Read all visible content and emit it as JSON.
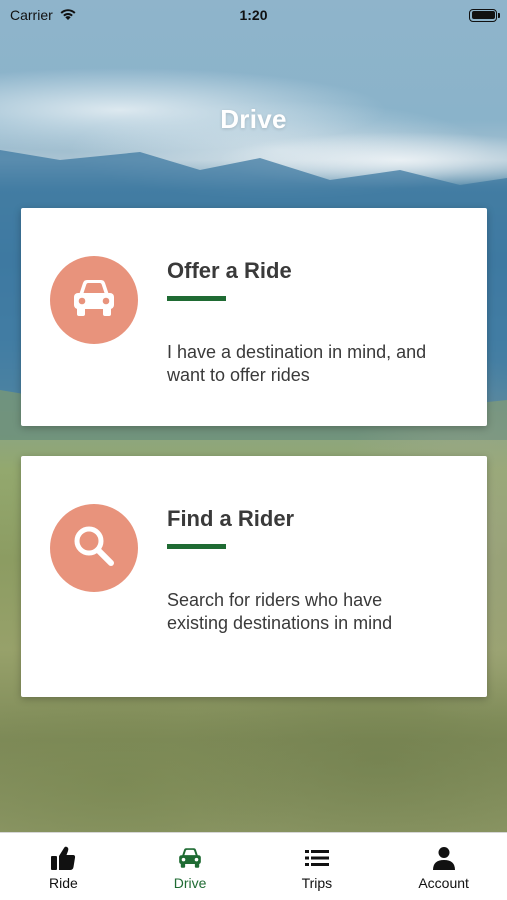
{
  "status_bar": {
    "carrier": "Carrier",
    "time": "1:20"
  },
  "page": {
    "title": "Drive"
  },
  "cards": [
    {
      "title": "Offer a Ride",
      "description": "I have a destination in mind, and want to offer rides",
      "icon": "car-icon"
    },
    {
      "title": "Find a Rider",
      "description": "Search for riders who have existing destinations in mind",
      "icon": "search-icon"
    }
  ],
  "tab_bar": {
    "active": "Drive",
    "tabs": [
      {
        "label": "Ride",
        "icon": "thumbs-up-icon"
      },
      {
        "label": "Drive",
        "icon": "car-icon"
      },
      {
        "label": "Trips",
        "icon": "list-icon"
      },
      {
        "label": "Account",
        "icon": "person-icon"
      }
    ]
  },
  "colors": {
    "accent_green": "#1f6b33",
    "icon_circle": "#e8937c",
    "text_dark": "#3a3a3a"
  }
}
